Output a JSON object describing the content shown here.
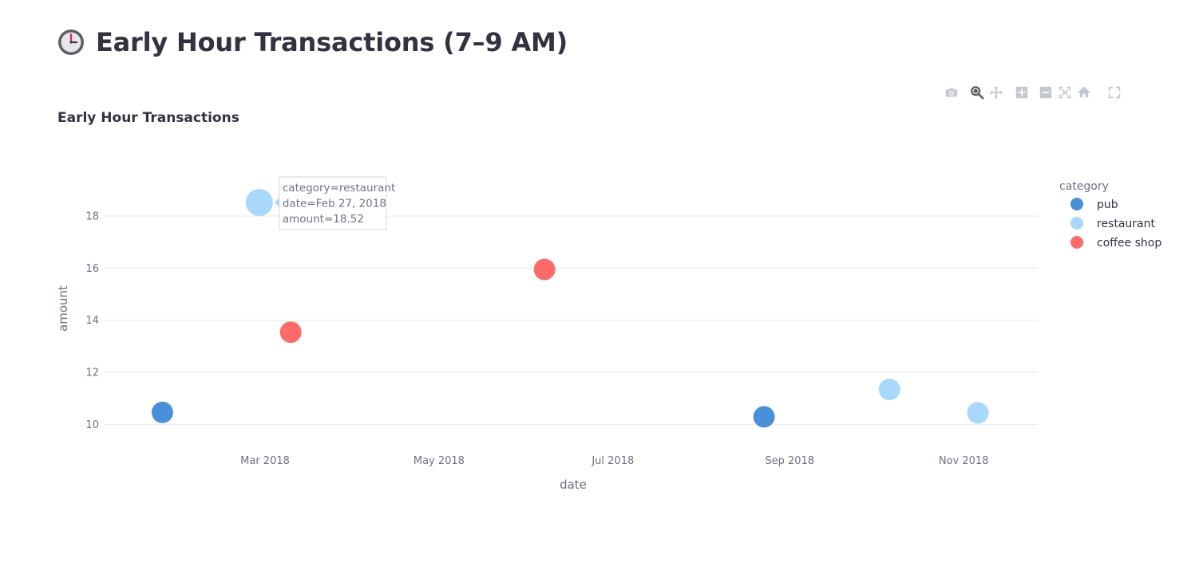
{
  "page": {
    "title": "Early Hour Transactions (7–9 AM)",
    "title_icon": "clock-icon"
  },
  "modebar": {
    "buttons": [
      "camera-icon",
      "zoom-icon",
      "pan-icon",
      "zoom-in-icon",
      "zoom-out-icon",
      "autoscale-icon",
      "reset-axes-icon",
      "fullscreen-icon"
    ]
  },
  "colors": {
    "pub": "#4a90d9",
    "restaurant": "#a8d8fc",
    "coffee shop": "#ff6b6b",
    "grid": "#e6e9ef",
    "axis_text": "#6b7385"
  },
  "chart_data": {
    "type": "scatter",
    "title": "Early Hour Transactions",
    "xlabel": "date",
    "ylabel": "amount",
    "xlim": [
      "2018-01-04",
      "2018-11-27"
    ],
    "ylim": [
      9.0,
      19.5
    ],
    "x_ticks": [
      {
        "value": "2018-03-01",
        "label": "Mar 2018"
      },
      {
        "value": "2018-05-01",
        "label": "May 2018"
      },
      {
        "value": "2018-07-01",
        "label": "Jul 2018"
      },
      {
        "value": "2018-09-01",
        "label": "Sep 2018"
      },
      {
        "value": "2018-11-01",
        "label": "Nov 2018"
      }
    ],
    "y_ticks": [
      10,
      12,
      14,
      16,
      18
    ],
    "grid": true,
    "legend": {
      "title": "category",
      "placement": "right"
    },
    "series": [
      {
        "name": "pub",
        "color": "#4a90d9",
        "points": [
          {
            "x": "2018-01-24",
            "y": 10.46
          },
          {
            "x": "2018-08-23",
            "y": 10.29
          }
        ]
      },
      {
        "name": "restaurant",
        "color": "#a8d8fc",
        "points": [
          {
            "x": "2018-02-27",
            "y": 18.52
          },
          {
            "x": "2018-10-06",
            "y": 11.34
          },
          {
            "x": "2018-11-06",
            "y": 10.44
          }
        ]
      },
      {
        "name": "coffee shop",
        "color": "#ff6b6b",
        "points": [
          {
            "x": "2018-03-10",
            "y": 13.54
          },
          {
            "x": "2018-06-07",
            "y": 15.95
          }
        ]
      }
    ],
    "hover": {
      "series": "restaurant",
      "x": "2018-02-27",
      "y": 18.52,
      "lines": [
        "category=restaurant",
        "date=Feb 27, 2018",
        "amount=18.52"
      ]
    }
  }
}
